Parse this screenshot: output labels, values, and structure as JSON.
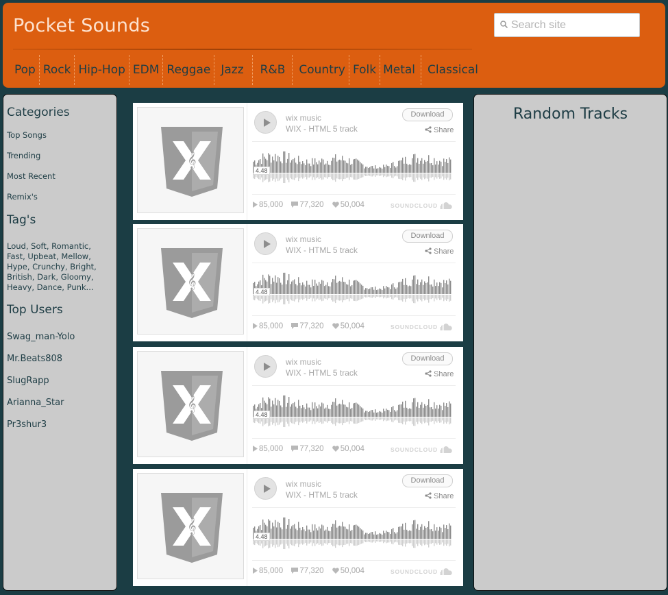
{
  "header": {
    "site_title": "Pocket Sounds",
    "search_placeholder": "Search site",
    "nav": [
      "Pop",
      "Rock",
      "Hip-Hop",
      "EDM",
      "Reggae",
      "Jazz",
      "R&B",
      "Country",
      "Folk",
      "Metal",
      "Classical"
    ]
  },
  "sidebar": {
    "categories_heading": "Categories",
    "categories": [
      "Top Songs",
      "Trending",
      "Most Recent",
      "Remix's"
    ],
    "tags_heading": "Tag's",
    "tags_lines": [
      "Loud, Soft, Romantic,",
      "Fast, Upbeat, Mellow,",
      "Hype, Crunchy, Bright,",
      "British, Dark, Gloomy,",
      "Heavy, Dance, Punk..."
    ],
    "top_users_heading": "Top Users",
    "top_users": [
      "Swag_man-Yolo",
      "Mr.Beats808",
      "SlugRapp",
      "Arianna_Star",
      "Pr3shur3"
    ]
  },
  "right_panel": {
    "title": "Random Tracks"
  },
  "tracks": [
    {
      "artist": "wix music",
      "title": "WIX - HTML 5 track",
      "duration": "4.48",
      "download_label": "Download",
      "share_label": "Share",
      "plays": "85,000",
      "comments": "77,320",
      "likes": "50,004",
      "brand": "SOUNDCLOUD"
    },
    {
      "artist": "wix music",
      "title": "WIX - HTML 5 track",
      "duration": "4.48",
      "download_label": "Download",
      "share_label": "Share",
      "plays": "85,000",
      "comments": "77,320",
      "likes": "50,004",
      "brand": "SOUNDCLOUD"
    },
    {
      "artist": "wix music",
      "title": "WIX - HTML 5 track",
      "duration": "4.48",
      "download_label": "Download",
      "share_label": "Share",
      "plays": "85,000",
      "comments": "77,320",
      "likes": "50,004",
      "brand": "SOUNDCLOUD"
    },
    {
      "artist": "wix music",
      "title": "WIX - HTML 5 track",
      "duration": "4.48",
      "download_label": "Download",
      "share_label": "Share",
      "plays": "85,000",
      "comments": "77,320",
      "likes": "50,004",
      "brand": "SOUNDCLOUD"
    }
  ],
  "colors": {
    "header_bg": "#dc5e10",
    "page_bg": "#1b3d44",
    "panel_bg": "#cbcbcb",
    "text_dark": "#1e3d45"
  },
  "icons": {
    "search": "search-icon",
    "play": "play-icon",
    "share": "share-icon",
    "plays": "play-count-icon",
    "comments": "comment-icon",
    "likes": "heart-icon",
    "soundcloud": "soundcloud-cloud-icon",
    "artwork": "wix-html5-logo-icon"
  }
}
